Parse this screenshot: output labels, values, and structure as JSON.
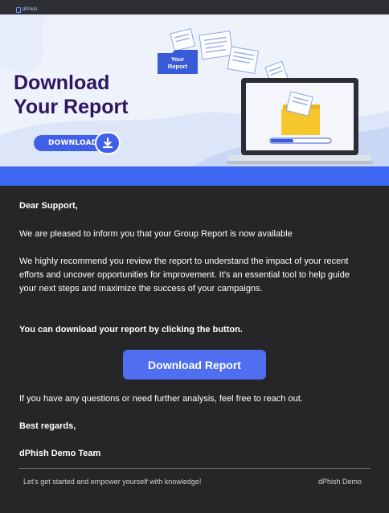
{
  "brand": {
    "text": "dPhish"
  },
  "hero": {
    "title_line1": "Download",
    "title_line2": "Your Report",
    "download_pill_label": "DOWNLOAD",
    "report_tag_line1": "Your",
    "report_tag_line2": "Report"
  },
  "body": {
    "greeting": "Dear Support,",
    "intro": "We are pleased to inform you that your Group Report is now available",
    "recommend": "We highly recommend you review the report to understand the impact of your recent efforts and uncover opportunities for improvement. It's an essential tool to help guide your next steps and maximize the success of your campaigns.",
    "download_hint": "You can download your report by clicking the button.",
    "cta_label": "Download Report",
    "questions": "If you have any questions or need further analysis, feel free to reach out.",
    "regards": "Best regards,",
    "team": "dPhish Demo Team"
  },
  "footer": {
    "tagline": "Let's get started and empower yourself with knowledge!",
    "company": "dPhish Demo"
  },
  "colors": {
    "accent": "#3d68f2",
    "button": "#4f6ef0",
    "title": "#2d1560",
    "background": "#262628"
  }
}
